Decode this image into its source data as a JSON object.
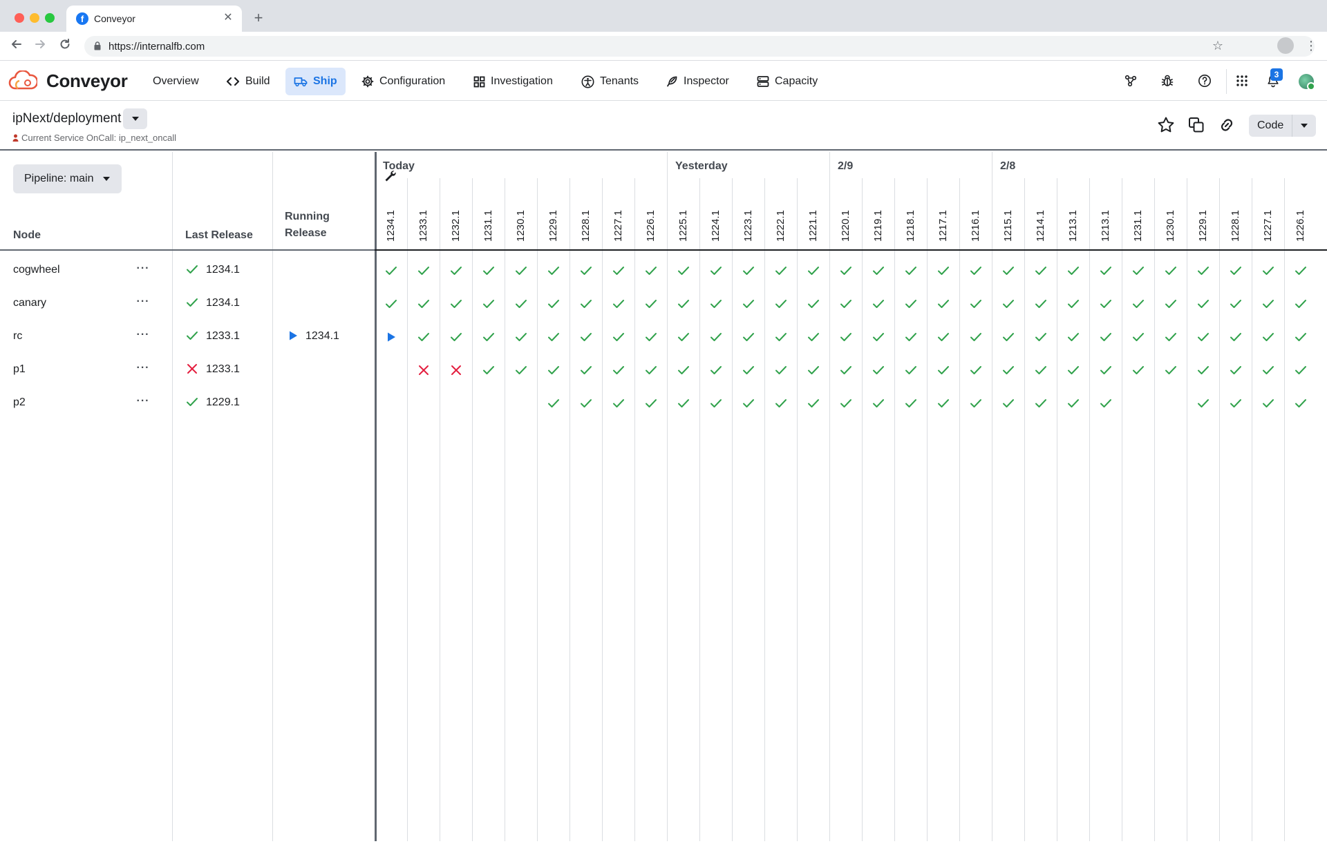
{
  "browser": {
    "tab_title": "Conveyor",
    "tab_favicon_letter": "f",
    "url": "https://internalfb.com"
  },
  "app": {
    "name": "Conveyor",
    "nav": [
      {
        "label": "Overview",
        "icon": "none",
        "active": false
      },
      {
        "label": "Build",
        "icon": "code-icon",
        "active": false
      },
      {
        "label": "Ship",
        "icon": "truck-icon",
        "active": true
      },
      {
        "label": "Configuration",
        "icon": "gear-icon",
        "active": false
      },
      {
        "label": "Investigation",
        "icon": "grid-icon",
        "active": false
      },
      {
        "label": "Tenants",
        "icon": "accessibility-icon",
        "active": false
      },
      {
        "label": "Inspector",
        "icon": "feather-icon",
        "active": false
      },
      {
        "label": "Capacity",
        "icon": "server-icon",
        "active": false
      }
    ],
    "notification_count": "3"
  },
  "page": {
    "title": "ipNext/deployment",
    "oncall": "Current Service OnCall: ip_next_oncall",
    "code_button": "Code"
  },
  "grid": {
    "pipeline_button": "Pipeline: main",
    "headers": {
      "node": "Node",
      "last_release": "Last Release",
      "running_release_1": "Running",
      "running_release_2": "Release"
    },
    "groups": [
      {
        "label": "Today",
        "start": 0,
        "count": 9
      },
      {
        "label": "Yesterday",
        "start": 9,
        "count": 5
      },
      {
        "label": "2/9",
        "start": 14,
        "count": 5
      },
      {
        "label": "2/8",
        "start": 19,
        "count": 10
      }
    ],
    "versions": [
      "1234.1",
      "1233.1",
      "1232.1",
      "1231.1",
      "1230.1",
      "1229.1",
      "1228.1",
      "1227.1",
      "1226.1",
      "1225.1",
      "1224.1",
      "1223.1",
      "1222.1",
      "1221.1",
      "1220.1",
      "1219.1",
      "1218.1",
      "1217.1",
      "1216.1",
      "1215.1",
      "1214.1",
      "1213.1",
      "1213.1",
      "1231.1",
      "1230.1",
      "1229.1",
      "1228.1",
      "1227.1",
      "1226.1"
    ],
    "nodes": [
      {
        "name": "cogwheel",
        "menu": "···",
        "last_release": "1234.1",
        "last_status": "success",
        "running_release": "",
        "running_status": "",
        "cells": "CCCCCCCCCCCCCCCCCCCCCCCCCCCCC"
      },
      {
        "name": "canary",
        "menu": "···",
        "last_release": "1234.1",
        "last_status": "success",
        "running_release": "",
        "running_status": "",
        "cells": "CCCCCCCCCCCCCCCCCCCCCCCCCCCCC"
      },
      {
        "name": "rc",
        "menu": "···",
        "last_release": "1233.1",
        "last_status": "success",
        "running_release": "1234.1",
        "running_status": "running",
        "cells": "RCCCCCCCCCCCCCCCCCCCCCCCCCCCC"
      },
      {
        "name": "p1",
        "menu": "···",
        "last_release": "1233.1",
        "last_status": "failed",
        "running_release": "",
        "running_status": "",
        "cells": "-XXCCCCCCCCCCCCCCCCCCCCCCCCCC"
      },
      {
        "name": "p2",
        "menu": "···",
        "last_release": "1229.1",
        "last_status": "success",
        "running_release": "",
        "running_status": "",
        "cells": "-----CCCCCCCCCCCCCCCCCC--CCCC"
      }
    ]
  },
  "colors": {
    "accent": "#1b74e4",
    "success": "#31a24c",
    "failure": "#e41e3f",
    "running": "#1b74e4"
  }
}
